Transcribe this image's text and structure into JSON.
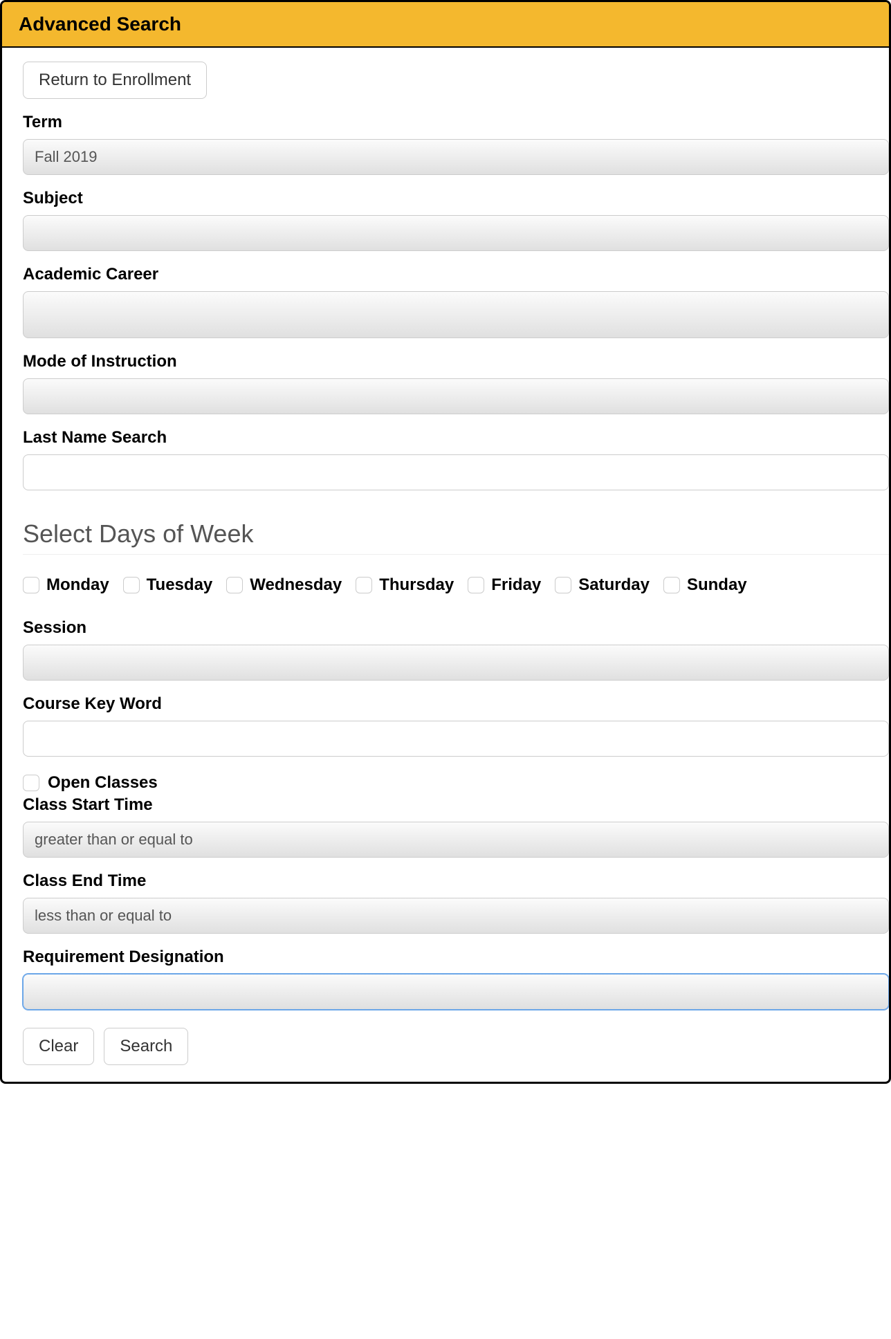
{
  "header": {
    "title": "Advanced Search"
  },
  "buttons": {
    "return": "Return to Enrollment",
    "clear": "Clear",
    "search": "Search"
  },
  "fields": {
    "term": {
      "label": "Term",
      "value": "Fall 2019"
    },
    "subject": {
      "label": "Subject",
      "value": ""
    },
    "academic_career": {
      "label": "Academic Career",
      "value": ""
    },
    "mode_of_instruction": {
      "label": "Mode of Instruction",
      "value": ""
    },
    "last_name": {
      "label": "Last Name Search",
      "value": ""
    },
    "session": {
      "label": "Session",
      "value": ""
    },
    "course_keyword": {
      "label": "Course Key Word",
      "value": ""
    },
    "open_classes": {
      "label": "Open Classes"
    },
    "class_start_time": {
      "label": "Class Start Time",
      "value": "greater than or equal to"
    },
    "class_end_time": {
      "label": "Class End Time",
      "value": "less than or equal to"
    },
    "requirement_designation": {
      "label": "Requirement Designation",
      "value": ""
    }
  },
  "days_section": {
    "heading": "Select Days of Week",
    "days": [
      "Monday",
      "Tuesday",
      "Wednesday",
      "Thursday",
      "Friday",
      "Saturday",
      "Sunday"
    ]
  }
}
